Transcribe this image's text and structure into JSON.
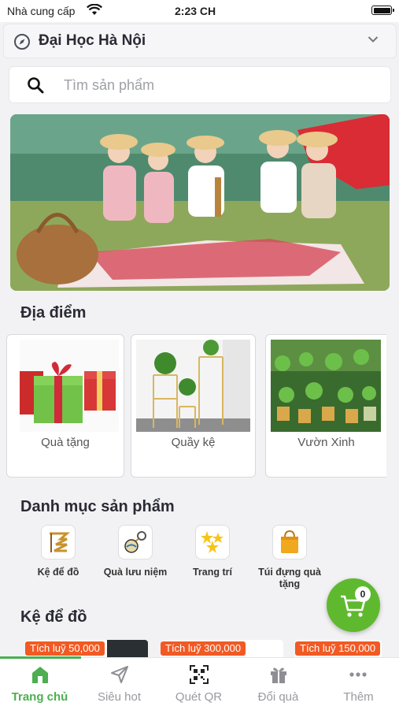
{
  "status_bar": {
    "carrier": "Nhà cung cấp",
    "time": "2:23 CH"
  },
  "location": {
    "name": "Đại Học Hà Nội"
  },
  "search": {
    "placeholder": "Tìm sản phẩm"
  },
  "places": {
    "title": "Địa điểm",
    "items": [
      {
        "label": "Quà tặng"
      },
      {
        "label": "Quầy kệ"
      },
      {
        "label": "Vườn Xinh"
      }
    ]
  },
  "categories": {
    "title": "Danh mục sản phẩm",
    "items": [
      {
        "label": "Kệ để đồ"
      },
      {
        "label": "Quà lưu niệm"
      },
      {
        "label": "Trang trí"
      },
      {
        "label": "Túi đựng quà tặng"
      }
    ]
  },
  "cart": {
    "count": "0"
  },
  "shelf_section": {
    "title": "Kệ để đồ",
    "products": [
      {
        "points": "Tích luỹ 50,000"
      },
      {
        "points": "Tích luỹ 300,000"
      },
      {
        "points": "Tích luỹ 150,000"
      }
    ]
  },
  "tabs": [
    {
      "label": "Trang chủ"
    },
    {
      "label": "Siêu hot"
    },
    {
      "label": "Quét QR"
    },
    {
      "label": "Đổi quà"
    },
    {
      "label": "Thêm"
    }
  ],
  "colors": {
    "accent": "#4caf50",
    "fab": "#5fb92e",
    "tag": "#f15a24"
  }
}
